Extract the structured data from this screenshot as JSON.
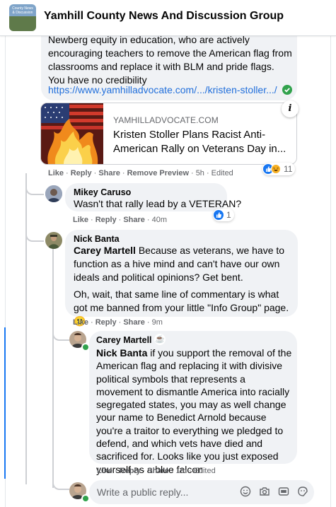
{
  "header": {
    "group_name": "Yamhill County News And Discussion Group",
    "thumb_text": "County News & Discussion"
  },
  "post_comment": {
    "text": "Newberg equity in education, who are actively encouraging teachers to remove the American flag from classrooms and replace it with BLM and pride flags. You have no credibility",
    "link_text": "https://www.yamhilladvocate.com/.../kristen-stoller.../",
    "preview": {
      "domain": "YAMHILLADVOCATE.COM",
      "title": "Kristen Stoller Plans Racist Anti-American Rally on Veterans Day in...",
      "info_label": "i"
    },
    "actions": [
      "Like",
      "Reply",
      "Share",
      "Remove Preview"
    ],
    "time": "5h",
    "edited": "Edited",
    "reaction_count": "11"
  },
  "comments": [
    {
      "author": "Mikey Caruso",
      "text": "Wasn't that rally lead by a VETERAN?",
      "actions": [
        "Like",
        "Reply",
        "Share"
      ],
      "time": "40m",
      "reaction_count": "1"
    },
    {
      "author": "Nick Banta",
      "tag": "Carey Martell",
      "text_1": " Because as veterans, we have to function as a hive mind and can't have our own ideals and political opinions? Get bent.",
      "text_2": "Oh, wait, that same line of commentary is what got me banned from your little \"Info Group\" page. 🙂",
      "actions": [
        "Like",
        "Reply",
        "Share"
      ],
      "time": "9m"
    },
    {
      "author": "Carey Martell",
      "badge": "☕",
      "tag": "Nick Banta",
      "text": " if you support the removal of the American flag and replacing it with divisive political symbols that represents a movement to dismantle America into racially segregated states, you may as well change your name to Benedict Arnold because you're a traitor to everything we pledged to defend, and which vets have died and sacrificed for. Looks like you just exposed yourself as a blue falcon",
      "actions": [
        "Like",
        "Reply",
        "Share"
      ],
      "time": "1m",
      "edited": "Edited"
    }
  ],
  "reply_box": {
    "placeholder": "Write a public reply...",
    "icons": [
      "emoji-icon",
      "camera-icon",
      "gif-icon",
      "sticker-icon"
    ]
  },
  "colors": {
    "link": "#216fdb",
    "like_blue": "#1877f2",
    "bubble": "#f0f2f5",
    "meta_gray": "#65676b"
  }
}
